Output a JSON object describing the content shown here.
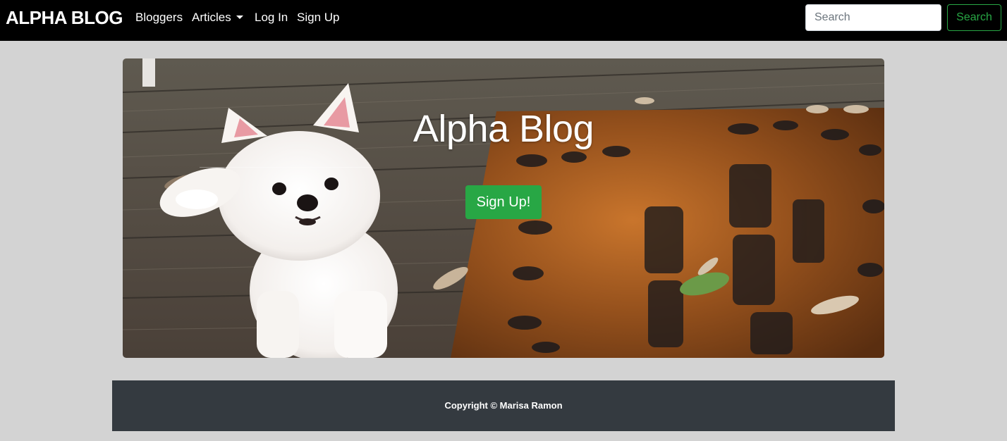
{
  "navbar": {
    "brand": "ALPHA BLOG",
    "links": [
      {
        "label": "Bloggers"
      },
      {
        "label": "Articles"
      },
      {
        "label": "Log In"
      },
      {
        "label": "Sign Up"
      }
    ],
    "search": {
      "placeholder": "Search",
      "value": "",
      "button_label": "Search"
    }
  },
  "hero": {
    "title": "Alpha Blog",
    "button_label": "Sign Up!",
    "image": "pomeranian-dog-on-doormat-photo"
  },
  "footer": {
    "copyright": "Copyright © Marisa Ramon"
  },
  "colors": {
    "navbar_bg": "#000000",
    "page_bg": "#d3d3d3",
    "accent_green": "#28a745",
    "footer_bg": "#343a40"
  }
}
